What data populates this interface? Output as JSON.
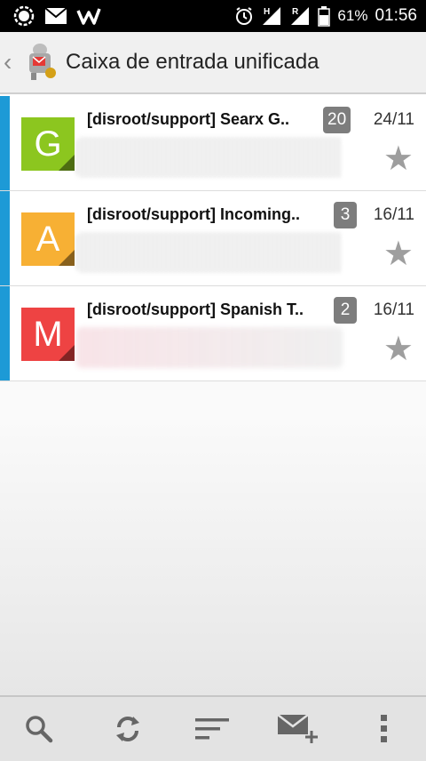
{
  "status_bar": {
    "battery": "61%",
    "time": "01:56",
    "icons": [
      "signal-messenger-icon",
      "mail-icon",
      "w-app-icon",
      "alarm-icon",
      "signal-h-icon",
      "signal-r-icon",
      "battery-icon"
    ]
  },
  "action_bar": {
    "title": "Caixa de entrada unificada",
    "up_icon": "chevron-left-icon",
    "app_icon": "k9-mail-icon"
  },
  "messages": [
    {
      "avatar_letter": "G",
      "avatar_color": "#8cc61f",
      "subject": "[disroot/support] Searx G..",
      "count": "20",
      "date": "24/11",
      "starred": false
    },
    {
      "avatar_letter": "A",
      "avatar_color": "#f7b034",
      "subject": "[disroot/support] Incoming..",
      "count": "3",
      "date": "16/11",
      "starred": false
    },
    {
      "avatar_letter": "M",
      "avatar_color": "#ee4343",
      "subject": "[disroot/support] Spanish T..",
      "count": "2",
      "date": "16/11",
      "starred": false
    }
  ],
  "colors": {
    "unread_bar": "#1d9ad6",
    "count_badge": "#7d7d7d"
  },
  "bottom_bar": {
    "buttons": [
      "search-icon",
      "refresh-icon",
      "sort-icon",
      "compose-icon",
      "overflow-menu-icon"
    ]
  }
}
